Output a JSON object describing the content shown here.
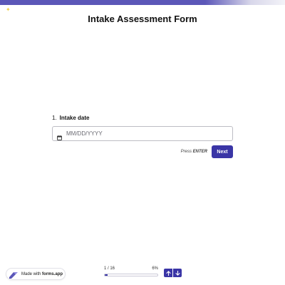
{
  "form": {
    "title": "Intake Assessment Form"
  },
  "question": {
    "number": "1.",
    "label": "Intake date",
    "placeholder": "MM/DD/YYYY",
    "value": ""
  },
  "actions": {
    "press_prefix": "Press",
    "press_key": "ENTER",
    "next_label": "Next"
  },
  "footer": {
    "badge_prefix": "Made with",
    "badge_brand": "forms.app",
    "progress_count": "1 / 16",
    "progress_percent_label": "6%",
    "progress_fraction": 0.06
  },
  "colors": {
    "accent": "#3a35a6",
    "top_bar": "#5b57b8",
    "sparkle": "#f2d14b"
  },
  "icons": {
    "calendar": "calendar-icon",
    "up": "arrow-up-icon",
    "down": "arrow-down-icon",
    "logo": "forms-app-logo-icon"
  }
}
